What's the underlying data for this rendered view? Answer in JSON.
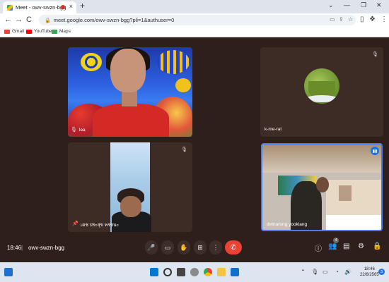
{
  "browser": {
    "tab_title": "Meet - owv-swzn-bgg",
    "tab_close": "×",
    "new_tab": "+",
    "window_controls": [
      "⌄",
      "—",
      "❐",
      "✕"
    ],
    "url": "meet.google.com/owv-swzn-bgg?pli=1&authuser=0",
    "nav": {
      "back": "←",
      "forward": "→",
      "reload": "C"
    },
    "bookmarks": [
      {
        "label": "Gmail",
        "color": "#ea4335"
      },
      {
        "label": "YouTube",
        "color": "#ff0000"
      },
      {
        "label": "Maps",
        "color": "#34a853"
      }
    ]
  },
  "participants": [
    {
      "name": "lea"
    },
    {
      "name": "k-me-rat"
    },
    {
      "name": "เดช ประสุข พรชนะ"
    },
    {
      "name": "detnarong yooklang"
    }
  ],
  "meeting": {
    "time": "18:46",
    "separator": "|",
    "code": "owv-swzn-bgg",
    "participant_count": "4"
  },
  "controls": {
    "mic": "🎤",
    "camera": "▭",
    "hand": "✋",
    "present": "⊞",
    "more": "⋮",
    "end": "✆",
    "info": "ⓘ",
    "people": "👥",
    "chat": "▤",
    "activities": "⚙",
    "lock": "🔒"
  },
  "taskbar": {
    "time": "18:46",
    "date": "22/6/2565",
    "notifications": "3",
    "accent": "#1a73e8"
  }
}
